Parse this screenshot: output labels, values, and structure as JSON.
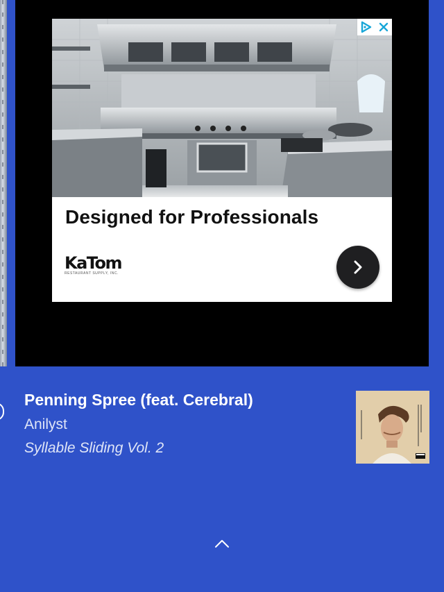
{
  "ad": {
    "headline": "Designed for Professionals",
    "advertiser_logo": "KaTom",
    "advertiser_logo_sub": "RESTAURANT SUPPLY, INC.",
    "cta_icon": "chevron-right-icon",
    "adchoices_icon": "adchoices-triangle-icon",
    "close_icon": "close-icon"
  },
  "now_playing": {
    "title": "Penning Spree (feat. Cerebral)",
    "artist": "Anilyst",
    "album": "Syllable Sliding Vol. 2"
  },
  "controls": {
    "expand_icon": "chevron-up-icon"
  },
  "colors": {
    "background": "#2f52c9",
    "ad_panel": "#000000",
    "ad_card": "#ffffff",
    "cta": "#1f1f21",
    "adchoices": "#17a6d8"
  }
}
